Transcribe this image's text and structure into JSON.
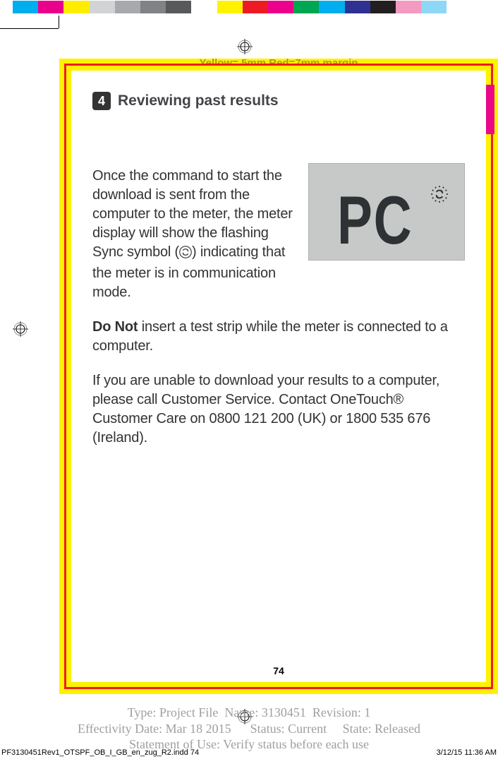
{
  "colorbar": [
    "#00adef",
    "#eb008b",
    "#ffed00",
    "#d1d3d4",
    "#a7a9ac",
    "#808285",
    "#58595b",
    "#ffffff",
    "#fff200",
    "#ed1c24",
    "#ec008c",
    "#00a651",
    "#00aeef",
    "#2e3192",
    "#231f20",
    "#f49ac1",
    "#8dd7f7",
    "#ffffff",
    "#ffffff"
  ],
  "margin_note": "Yellow= 5mm  Red=7mm margin",
  "section": {
    "number": "4",
    "title": "Reviewing past results"
  },
  "body": {
    "p1": "Once the command to start the download is sent from the computer to the meter, the meter display will show the flashing Sync symbol (",
    "p1b": ") indicating that the meter is in communication mode.",
    "p2a": "Do Not",
    "p2b": " insert a test strip while the meter is connected to a computer.",
    "p3": "If you are unable to download your results to a computer, please call Customer Service. Contact OneTouch® Customer Care on 0800 121 200 (UK) or 1800 535 676 (Ireland)."
  },
  "lcd_text": "PC",
  "page_number": "74",
  "meta": {
    "line1": "Type: Project File  Name: 3130451  Revision: 1",
    "line2": "Effectivity Date: Mar 18 2015      Status: Current     State: Released",
    "line3": "Statement of Use: Verify status before each use"
  },
  "footer": {
    "indd": "PF3130451Rev1_OTSPF_OB_I_GB_en_zug_R2.indd   74",
    "timestamp": "3/12/15   11:36 AM"
  }
}
